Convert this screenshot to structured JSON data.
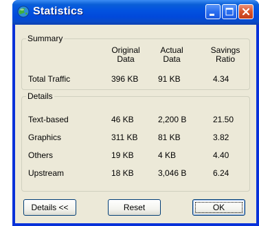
{
  "window": {
    "title": "Statistics",
    "icon": "globe-icon",
    "controls": [
      "minimize-icon",
      "maximize-icon",
      "close-icon"
    ]
  },
  "summary": {
    "legend": "Summary",
    "headers": {
      "original": "Original Data",
      "original_line1": "Original",
      "original_line2": "Data",
      "actual": "Actual Data",
      "actual_line1": "Actual",
      "actual_line2": "Data",
      "ratio": "Savings Ratio",
      "ratio_line1": "Savings",
      "ratio_line2": "Ratio"
    },
    "rows": [
      {
        "label": "Total Traffic",
        "original": "396 KB",
        "actual": "91 KB",
        "ratio": "4.34"
      }
    ]
  },
  "details": {
    "legend": "Details",
    "rows": [
      {
        "label": "Text-based",
        "original": "46 KB",
        "actual": "2,200 B",
        "ratio": "21.50"
      },
      {
        "label": "Graphics",
        "original": "311 KB",
        "actual": "81 KB",
        "ratio": "3.82"
      },
      {
        "label": "Others",
        "original": "19 KB",
        "actual": "4 KB",
        "ratio": "4.40"
      },
      {
        "label": "Upstream",
        "original": "18 KB",
        "actual": "3,046 B",
        "ratio": "6.24"
      }
    ]
  },
  "buttons": {
    "details": "Details <<",
    "reset": "Reset",
    "ok": "OK"
  },
  "colors": {
    "title_bar": "#0253e0",
    "window_border": "#0831d9",
    "dialog_bg": "#ece9d8",
    "close_button": "#d8532a"
  }
}
